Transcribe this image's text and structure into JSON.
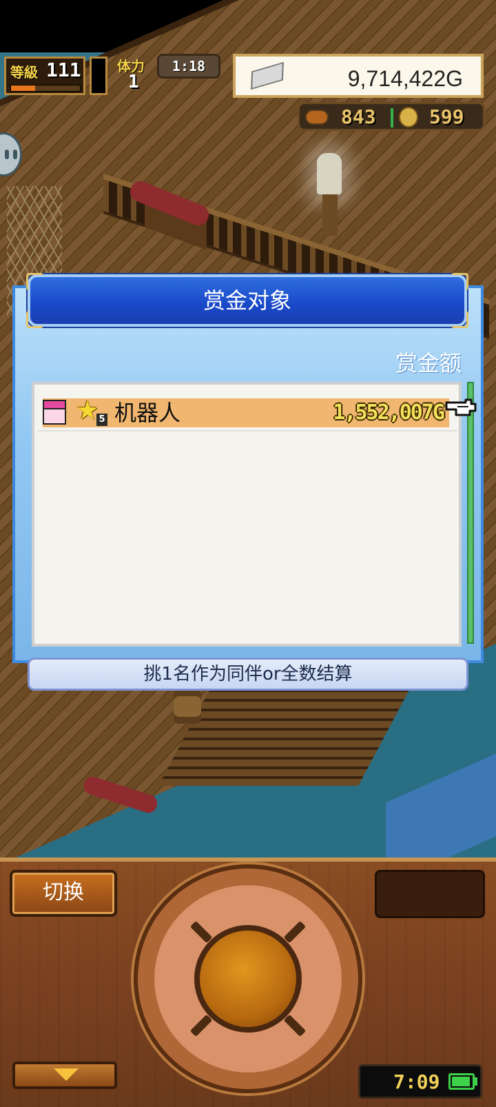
{
  "hud": {
    "level_label": "等級",
    "level_value": "111",
    "level_progress": 0.35,
    "stamina_label": "体力",
    "stamina_value": "1",
    "timer": "1:18",
    "gold": "9,714,422G",
    "meat": "843",
    "coins": "599"
  },
  "dialog": {
    "title": "赏金对象",
    "column_header": "赏金额",
    "rows": [
      {
        "name": "机器人",
        "rank": "5",
        "amount": "1,552,007G",
        "selected": true
      }
    ],
    "footer_note": "挑1名作为同伴or全数结算"
  },
  "controls": {
    "switch_label": "切换",
    "clock": "7:09",
    "battery_level": 0.85
  },
  "colors": {
    "dialog_header": "#1848c8",
    "dialog_body": "#92c8f2",
    "row_highlight": "#f1b66f",
    "amount_text": "#f4e05a",
    "panel_wood": "#7a4120",
    "battery": "#3ed24a"
  },
  "icons": {
    "gift": "gift-box-icon",
    "star": "star-icon",
    "pointer": "pointing-hand-icon",
    "silver": "silver-ingot-icon",
    "meat": "meat-icon",
    "coin": "coin-icon",
    "chat": "chat-bubble-icon",
    "down": "down-arrow-icon",
    "battery": "battery-icon"
  }
}
